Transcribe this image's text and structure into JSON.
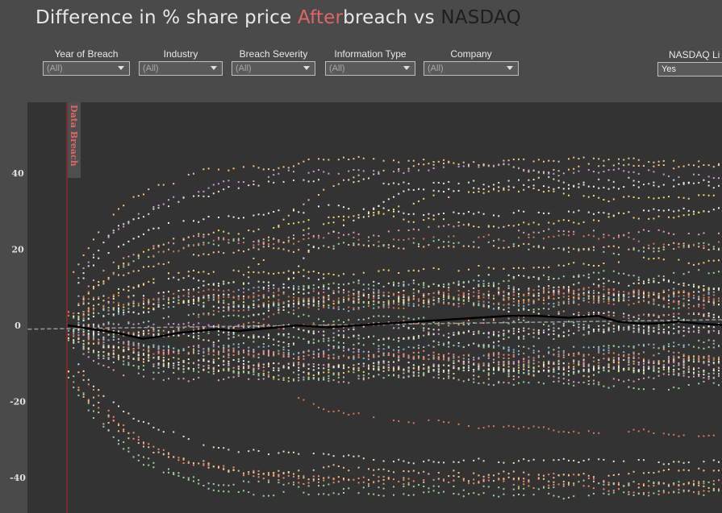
{
  "title": {
    "part1": "Difference in % share price",
    "after": "After",
    "part2": "breach",
    "vs": "vs",
    "nasdaq": "NASDAQ"
  },
  "filters": [
    {
      "label": "Year of Breach",
      "value": "(All)"
    },
    {
      "label": "Industry",
      "value": "(All)"
    },
    {
      "label": "Breach Severity",
      "value": "(All)"
    },
    {
      "label": "Information Type",
      "value": "(All)"
    },
    {
      "label": "Company",
      "value": "(All)"
    },
    {
      "label": "NASDAQ Li",
      "value": "Yes"
    }
  ],
  "annotation": "Data Breach",
  "colors": {
    "background": "#4a4a4a",
    "plot": "#333333",
    "accent": "#e06666",
    "marker_line": "#8b2a2a",
    "nasdaq_line": "#9a9a9a",
    "average_line": "#000000",
    "dots": [
      "#e8e4c8",
      "#f2efe2",
      "#f5c78a",
      "#f08c6e",
      "#d9795e",
      "#9fd3a0",
      "#8ab4d8",
      "#e0a0c0",
      "#f5d76e",
      "#c9a0dc"
    ]
  },
  "chart_data": {
    "type": "scatter",
    "ylabel": "",
    "ylim": [
      -49,
      59
    ],
    "yticks": [
      40,
      20,
      0,
      -20,
      -40
    ],
    "grid": false,
    "series": [
      {
        "name": "",
        "kind": "average-line",
        "x": [
          0,
          5,
          10,
          15,
          18,
          22,
          26,
          30,
          34,
          38,
          42,
          46,
          52,
          58,
          64,
          70,
          76,
          82,
          88,
          94,
          100,
          106,
          110,
          114,
          118,
          122,
          126,
          132
        ],
        "values": [
          0,
          -1,
          -2,
          -3.5,
          -3,
          -2,
          -1.5,
          -1,
          -1.5,
          -1,
          -0.5,
          0,
          -0.5,
          0,
          0.5,
          1,
          1.5,
          2,
          2.5,
          2.5,
          2,
          2.5,
          1,
          0.5,
          0.5,
          1,
          0.5,
          0
        ]
      },
      {
        "name": "NASDAQ",
        "kind": "dashed-line",
        "x": [
          -8,
          132
        ],
        "values": [
          -1,
          1.5
        ]
      }
    ]
  }
}
